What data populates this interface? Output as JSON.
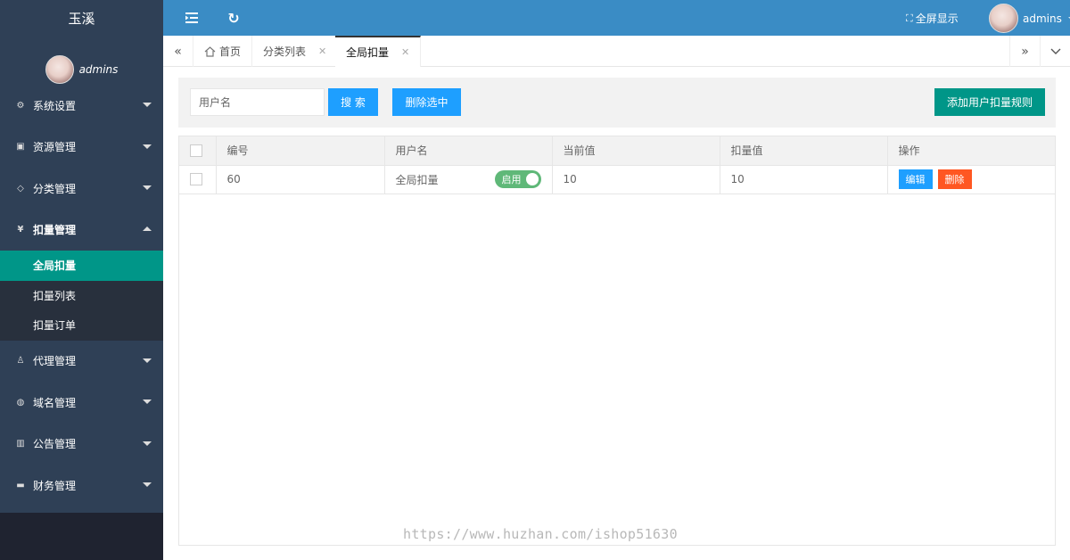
{
  "app": {
    "title": "玉溪"
  },
  "user": {
    "name": "admins"
  },
  "header": {
    "fullscreen_label": "全屏显示",
    "user_name": "admins"
  },
  "nav": {
    "items": [
      {
        "label": "系统设置",
        "icon": "gear-icon"
      },
      {
        "label": "资源管理",
        "icon": "play-icon"
      },
      {
        "label": "分类管理",
        "icon": "tag-icon"
      },
      {
        "label": "扣量管理",
        "icon": "yen-icon"
      },
      {
        "label": "代理管理",
        "icon": "user-icon"
      },
      {
        "label": "域名管理",
        "icon": "globe-icon"
      },
      {
        "label": "公告管理",
        "icon": "book-icon"
      },
      {
        "label": "财务管理",
        "icon": "wallet-icon"
      }
    ],
    "sub_items": [
      {
        "label": "全局扣量"
      },
      {
        "label": "扣量列表"
      },
      {
        "label": "扣量订单"
      }
    ]
  },
  "tabs": [
    {
      "label": "首页"
    },
    {
      "label": "分类列表"
    },
    {
      "label": "全局扣量"
    }
  ],
  "toolbar": {
    "search_placeholder": "用户名",
    "search_label": "搜 索",
    "delete_selected_label": "删除选中",
    "add_rule_label": "添加用户扣量规则"
  },
  "table": {
    "columns": [
      "编号",
      "用户名",
      "当前值",
      "扣量值",
      "操作"
    ],
    "rows": [
      {
        "id": "60",
        "username": "全局扣量",
        "switch_label": "启用",
        "current": "10",
        "deduct": "10",
        "edit_label": "编辑",
        "delete_label": "删除"
      }
    ]
  },
  "watermark": "https://www.huzhan.com/ishop51630",
  "colors": {
    "sidebar": "#2F4056",
    "header": "#3a8cc5",
    "active": "#009688",
    "blue": "#1E9FFF",
    "red": "#FF5722",
    "switch": "#5FB878"
  }
}
